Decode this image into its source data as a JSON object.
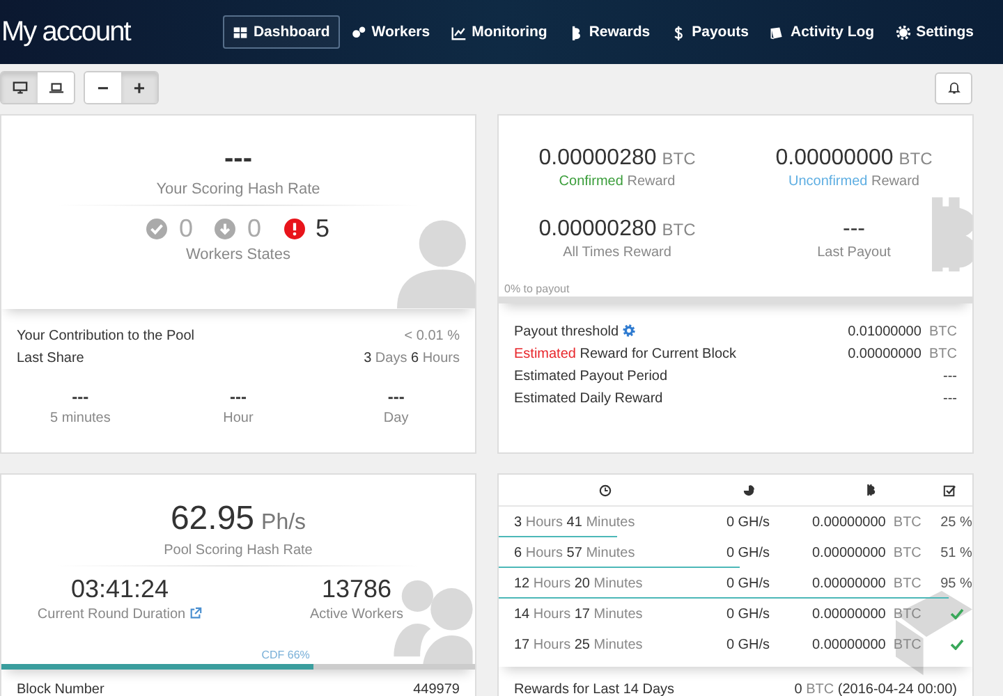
{
  "header": {
    "title": "My account",
    "nav": [
      {
        "label": "Dashboard",
        "selected": true
      },
      {
        "label": "Workers",
        "selected": false
      },
      {
        "label": "Monitoring",
        "selected": false
      },
      {
        "label": "Rewards",
        "selected": false
      },
      {
        "label": "Payouts",
        "selected": false
      },
      {
        "label": "Activity Log",
        "selected": false
      },
      {
        "label": "Settings",
        "selected": false
      }
    ]
  },
  "toolbar": {
    "view_buttons": [
      {
        "selected": true
      },
      {
        "selected": false
      }
    ],
    "zoom_buttons": [
      {
        "label": "−",
        "selected": false
      },
      {
        "label": "+",
        "selected": true
      }
    ]
  },
  "worker_card": {
    "hash_rate": "---",
    "hash_rate_label": "Your Scoring Hash Rate",
    "states": [
      {
        "kind": "ok",
        "count": "0"
      },
      {
        "kind": "down",
        "count": "0"
      },
      {
        "kind": "alert",
        "count": "5"
      }
    ],
    "states_label": "Workers States",
    "details": [
      {
        "label": "Your Contribution to the Pool",
        "value": "< 0.01 %"
      },
      {
        "label": "Last Share",
        "value": "**3** Days **6** Hours"
      }
    ],
    "periods": [
      {
        "value": "---",
        "label": "5 minutes"
      },
      {
        "value": "---",
        "label": "Hour"
      },
      {
        "value": "---",
        "label": "Day"
      }
    ]
  },
  "reward_card": {
    "rewards": [
      {
        "amount": "0.00000280",
        "unit": "BTC",
        "highlight": "Confirmed",
        "color": "#3a9d3a",
        "label": "Reward"
      },
      {
        "amount": "0.00000000",
        "unit": "BTC",
        "highlight": "Unconfirmed",
        "color": "#5eaee2",
        "label": "Reward"
      },
      {
        "amount": "0.00000280",
        "unit": "BTC",
        "label": "All Times Reward"
      },
      {
        "amount": "---",
        "label": "Last Payout"
      }
    ],
    "payout": {
      "label": "0% to payout",
      "level": 0
    },
    "details": [
      {
        "label": "Payout threshold",
        "settings": true,
        "value": "0.01000000",
        "unit": "BTC"
      },
      {
        "highlight": "Estimated",
        "color": "#e8262b",
        "label": "Reward for Current Block",
        "settings": false,
        "value": "0.00000000",
        "unit": "BTC"
      },
      {
        "label": "Estimated Payout Period",
        "settings": false,
        "value": "---"
      },
      {
        "label": "Estimated Daily Reward",
        "settings": false,
        "value": "---"
      }
    ]
  },
  "pool_card": {
    "hash_rate": "62.95",
    "unit": "Ph/s",
    "hash_rate_label": "Pool Scoring Hash Rate",
    "stats": [
      {
        "value": "03:41:24",
        "label": "Current Round Duration",
        "link": true
      },
      {
        "value": "13786",
        "label": "Active Workers",
        "link": false
      }
    ],
    "cdf": {
      "label": "CDF 66%",
      "level": 0.66
    },
    "details": [
      {
        "label": "Block Number",
        "value": "449979"
      }
    ]
  },
  "rounds_card": {
    "rows": [
      {
        "kind": "progress",
        "duration": "**3** Hours **41** Minutes",
        "hash_rate": "0 GH/s",
        "reward": "0.00000000",
        "unit": "BTC",
        "progress": "25 %",
        "level": 0.25
      },
      {
        "kind": "progress",
        "duration": "**6** Hours **57** Minutes",
        "hash_rate": "0 GH/s",
        "reward": "0.00000000",
        "unit": "BTC",
        "progress": "51 %",
        "level": 0.51
      },
      {
        "kind": "progress",
        "duration": "**12** Hours **20** Minutes",
        "hash_rate": "0 GH/s",
        "reward": "0.00000000",
        "unit": "BTC",
        "progress": "95 %",
        "level": 0.95
      },
      {
        "kind": "done",
        "duration": "**14** Hours **17** Minutes",
        "hash_rate": "0 GH/s",
        "reward": "0.00000000",
        "unit": "BTC"
      },
      {
        "kind": "done",
        "duration": "**17** Hours **25** Minutes",
        "hash_rate": "0 GH/s",
        "reward": "0.00000000",
        "unit": "BTC"
      }
    ],
    "footer": {
      "label": "Rewards for Last 14 Days",
      "value": "0",
      "unit": "BTC",
      "date": "(2016-04-24 00:00)"
    }
  }
}
